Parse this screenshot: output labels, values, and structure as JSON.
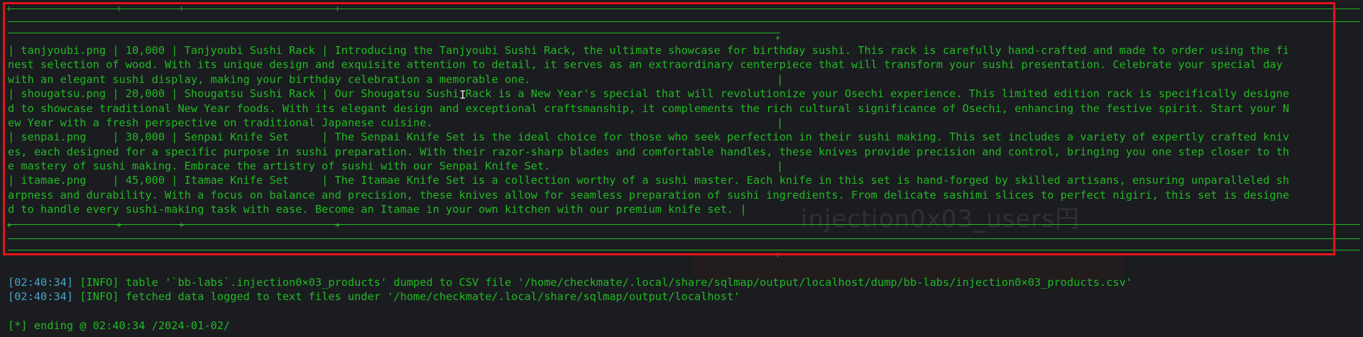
{
  "background_ghost": {
    "heading": "injection0x03_users円"
  },
  "table": {
    "rows": [
      "| tanjyoubi.png | 10,000 | Tanjyoubi Sushi Rack | Introducing the Tanjyoubi Sushi Rack, the ultimate showcase for birthday sushi. This rack is carefully hand-crafted and made to order using the fi",
      "nest selection of wood. With its unique design and exquisite attention to detail, it serves as an extraordinary centerpiece that will transform your sushi presentation. Celebrate your special day",
      "with an elegant sushi display, making your birthday celebration a memorable one.",
      "| shougatsu.png | 20,000 | Shougatsu Sushi Rack | Our Shougatsu Sushi Rack is a New Year's special that will revolutionize your Osechi experience. This limited edition rack is specifically designe",
      "d to showcase traditional New Year foods. With its elegant design and exceptional craftsmanship, it complements the rich cultural significance of Osechi, enhancing the festive spirit. Start your N",
      "ew Year with a fresh perspective on traditional Japanese cuisine.",
      "| senpai.png    | 30,000 | Senpai Knife Set     | The Senpai Knife Set is the ideal choice for those who seek perfection in their sushi making. This set includes a variety of expertly crafted kniv",
      "es, each designed for a specific purpose in sushi preparation. With their razor-sharp blades and comfortable handles, these knives provide precision and control, bringing you one step closer to th",
      "e mastery of sushi making. Embrace the artistry of sushi with our Senpai Knife Set.",
      "| itamae.png    | 45,000 | Itamae Knife Set     | The Itamae Knife Set is a collection worthy of a sushi master. Each knife in this set is hand-forged by skilled artisans, ensuring unparalleled sh",
      "arpness and durability. With a focus on balance and precision, these knives allow for seamless preparation of sushi ingredients. From delicate sashimi slices to perfect nigiri, this set is designe",
      "d to handle every sushi-making task with ease. Become an Itamae in your own kitchen with our premium knife set. |"
    ],
    "row_end_pipe": "|"
  },
  "log": [
    {
      "time": "[02:40:34]",
      "level": "[INFO]",
      "message": "table '`bb-labs`.injection0×03_products' dumped to CSV file '/home/checkmate/.local/share/sqlmap/output/localhost/dump/bb-labs/injection0×03_products.csv'"
    },
    {
      "time": "[02:40:34]",
      "level": "[INFO]",
      "message": "fetched data logged to text files under '/home/checkmate/.local/share/sqlmap/output/localhost'"
    }
  ],
  "ending": "[*] ending @ 02:40:34 /2024-01-02/",
  "colors": {
    "terminal_green": "#22b922",
    "timestamp_blue": "#4aa3c6",
    "selection_red": "#e3141c",
    "background": "#1a1c20"
  },
  "icons": {
    "cursor": "text-cursor-icon"
  }
}
